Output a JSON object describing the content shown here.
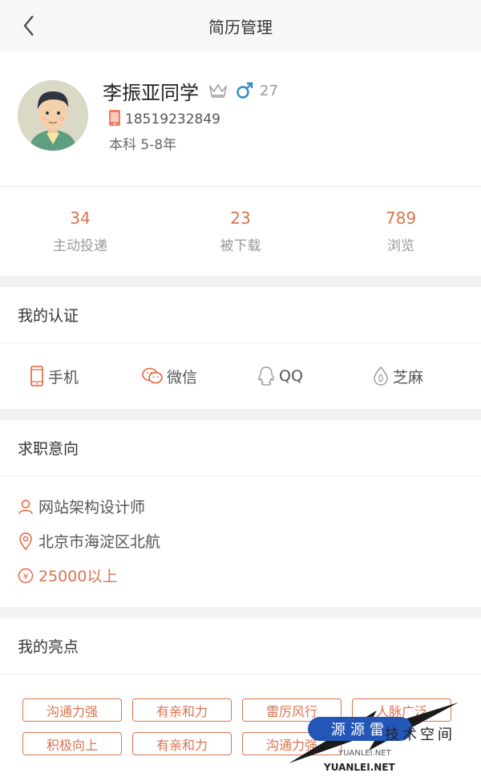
{
  "nav": {
    "title": "简历管理"
  },
  "profile": {
    "name": "李振亚同学",
    "age": "27",
    "phone": "18519232849",
    "education": "本科 5-8年"
  },
  "stats": [
    {
      "value": "34",
      "label": "主动投递"
    },
    {
      "value": "23",
      "label": "被下载"
    },
    {
      "value": "789",
      "label": "浏览"
    }
  ],
  "certification": {
    "title": "我的认证",
    "items": [
      {
        "label": "手机",
        "icon": "phone-icon",
        "color": "#e8603c"
      },
      {
        "label": "微信",
        "icon": "wechat-icon",
        "color": "#e8603c"
      },
      {
        "label": "QQ",
        "icon": "qq-icon",
        "color": "#9a9a9a"
      },
      {
        "label": "芝麻",
        "icon": "sesame-icon",
        "color": "#9a9a9a"
      }
    ]
  },
  "intent": {
    "title": "求职意向",
    "position": "网站架构设计师",
    "location": "北京市海淀区北航",
    "salary": "25000以上"
  },
  "highlights": {
    "title": "我的亮点",
    "tags": [
      "沟通力强",
      "有亲和力",
      "雷厉风行",
      "人脉广泛",
      "积极向上",
      "有亲和力",
      "沟通力强"
    ]
  },
  "watermark": {
    "badge": "源源雷",
    "side": "技术空间",
    "sub": "YUANLEI.NET",
    "url": "YUANLEI.NET"
  },
  "colors": {
    "accent": "#d9744f",
    "gender": "#2a8cc4"
  }
}
